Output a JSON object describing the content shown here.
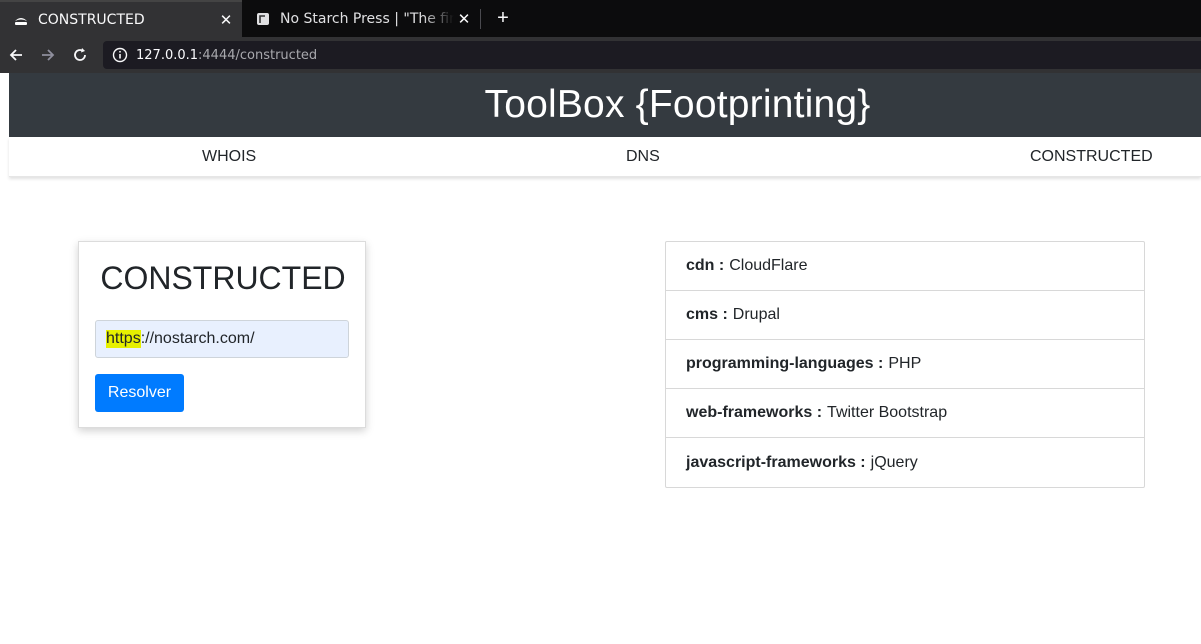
{
  "browser": {
    "tabs": [
      {
        "title": "CONSTRUCTED",
        "active": true,
        "icon": "site-favicon"
      },
      {
        "title": "No Starch Press | \"The finest in geek entertainment\"",
        "active": false,
        "icon": "nostarch-favicon"
      }
    ],
    "url_host": "127.0.0.1",
    "url_rest": ":4444/constructed"
  },
  "header": {
    "title": "ToolBox {Footprinting}"
  },
  "menu": {
    "items": [
      "WHOIS",
      "DNS",
      "CONSTRUCTED"
    ]
  },
  "card": {
    "title": "CONSTRUCTED",
    "input_highlight": "https",
    "input_rest": "://nostarch.com/",
    "button_label": "Resolver"
  },
  "results": [
    {
      "key": "cdn :",
      "value": "CloudFlare"
    },
    {
      "key": "cms :",
      "value": "Drupal"
    },
    {
      "key": "programming-languages :",
      "value": "PHP"
    },
    {
      "key": "web-frameworks :",
      "value": "Twitter Bootstrap"
    },
    {
      "key": "javascript-frameworks :",
      "value": "jQuery"
    }
  ],
  "colors": {
    "primary": "#007bff",
    "hero_bg": "#343a40",
    "highlight": "#e6f000"
  }
}
